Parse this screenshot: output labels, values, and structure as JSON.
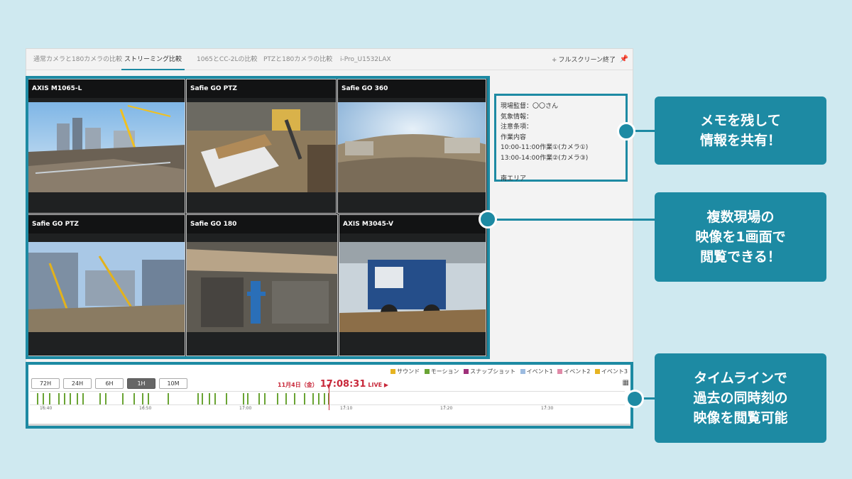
{
  "tabs": [
    {
      "label": "通常カメラと180カメラの比較",
      "active": false
    },
    {
      "label": "ストリーミング比較",
      "active": true
    },
    {
      "label": "1065とCC-2Lの比較",
      "active": false
    },
    {
      "label": "PTZと180カメラの比較",
      "active": false
    },
    {
      "label": "i-Pro_U1532LAX",
      "active": false
    }
  ],
  "toolbar": {
    "fullscreen_label": "フルスクリーン終了",
    "fullscreen_icon": "exit-fullscreen-icon",
    "pin_icon": "pin-icon"
  },
  "cameras": [
    {
      "name": "AXIS M1065-L"
    },
    {
      "name": "Safie GO PTZ"
    },
    {
      "name": "Safie GO 360"
    },
    {
      "name": "Safie GO PTZ"
    },
    {
      "name": "Safie GO 180"
    },
    {
      "name": "AXIS M3045-V"
    }
  ],
  "memo": {
    "lines": [
      "現場監督：〇〇さん",
      "気象情報：",
      "注意条項：",
      "作業内容",
      "10:00-11:00作業①(カメラ①)",
      "13:00-14:00作業②(カメラ③)",
      "",
      "南エリア"
    ]
  },
  "timeline": {
    "legend": [
      {
        "label": "サウンド",
        "color": "#e6b422"
      },
      {
        "label": "モーション",
        "color": "#6aa434"
      },
      {
        "label": "スナップショット",
        "color": "#a0307a"
      },
      {
        "label": "イベント1",
        "color": "#9cbbe0"
      },
      {
        "label": "イベント2",
        "color": "#e08aa8"
      },
      {
        "label": "イベント3",
        "color": "#e6b422"
      }
    ],
    "ranges": [
      {
        "label": "72H",
        "selected": false
      },
      {
        "label": "24H",
        "selected": false
      },
      {
        "label": "6H",
        "selected": false
      },
      {
        "label": "1H",
        "selected": true
      },
      {
        "label": "10M",
        "selected": false
      }
    ],
    "date": "11月4日（金）",
    "time": "17:08:31",
    "live_label": "LIVE ▶",
    "ticks": [
      "16:40",
      "16:50",
      "17:00",
      "17:10",
      "17:20",
      "17:30"
    ],
    "calendar_icon": "calendar-icon"
  },
  "callouts": [
    {
      "text": "メモを残して\n情報を共有！"
    },
    {
      "text": "複数現場の\n映像を1画面で\n閲覧できる！"
    },
    {
      "text": "タイムラインで\n過去の同時刻の\n映像を閲覧可能"
    }
  ]
}
